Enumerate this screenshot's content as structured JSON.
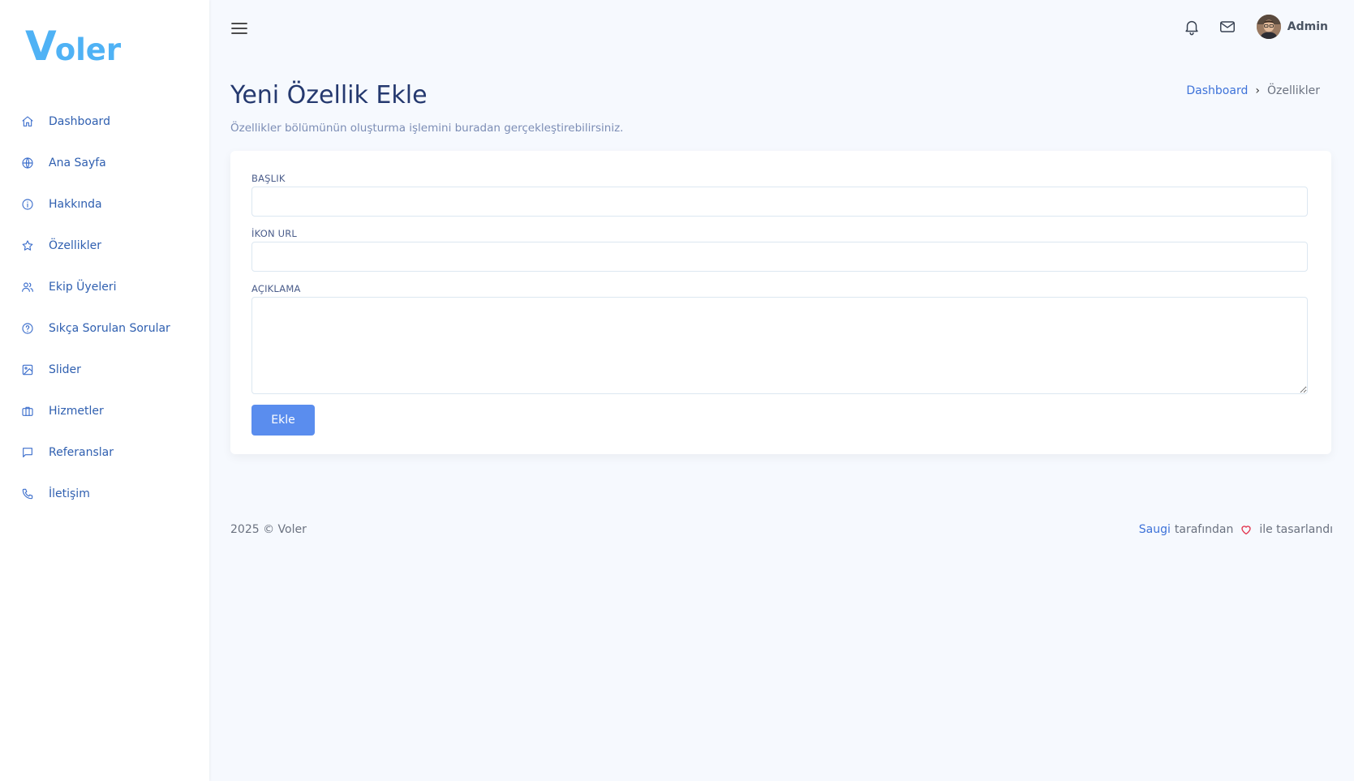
{
  "sidebar": {
    "logo": {
      "first": "V",
      "rest": "oler"
    },
    "items": [
      {
        "label": "Dashboard",
        "icon": "home-icon"
      },
      {
        "label": "Ana Sayfa",
        "icon": "globe-icon"
      },
      {
        "label": "Hakkında",
        "icon": "info-icon"
      },
      {
        "label": "Özellikler",
        "icon": "star-icon"
      },
      {
        "label": "Ekip Üyeleri",
        "icon": "users-icon"
      },
      {
        "label": "Sıkça Sorulan Sorular",
        "icon": "question-icon"
      },
      {
        "label": "Slider",
        "icon": "image-icon"
      },
      {
        "label": "Hizmetler",
        "icon": "briefcase-icon"
      },
      {
        "label": "Referanslar",
        "icon": "chat-icon"
      },
      {
        "label": "İletişim",
        "icon": "phone-icon"
      }
    ]
  },
  "topbar": {
    "user_name": "Admin"
  },
  "page": {
    "title": "Yeni Özellik Ekle",
    "subtitle": "Özellikler bölümünün oluşturma işlemini buradan gerçekleştirebilirsiniz."
  },
  "breadcrumb": {
    "link": "Dashboard",
    "current": "Özellikler"
  },
  "form": {
    "title_label": "BAŞLIK",
    "title_value": "",
    "icon_label": "İKON URL",
    "icon_value": "",
    "description_label": "AÇIKLAMA",
    "description_value": "",
    "submit_label": "Ekle"
  },
  "footer": {
    "copyright": "2025 © Voler",
    "author_link": "Saugi",
    "by_text": "tarafından",
    "designed_text": "ile tasarlandı"
  },
  "colors": {
    "accent": "#5a8dee",
    "logo": "#4fb2f5",
    "sidebar_text": "#2f5fb0",
    "title": "#25396f",
    "heart": "#e2364f",
    "background": "#f6f9fe"
  }
}
